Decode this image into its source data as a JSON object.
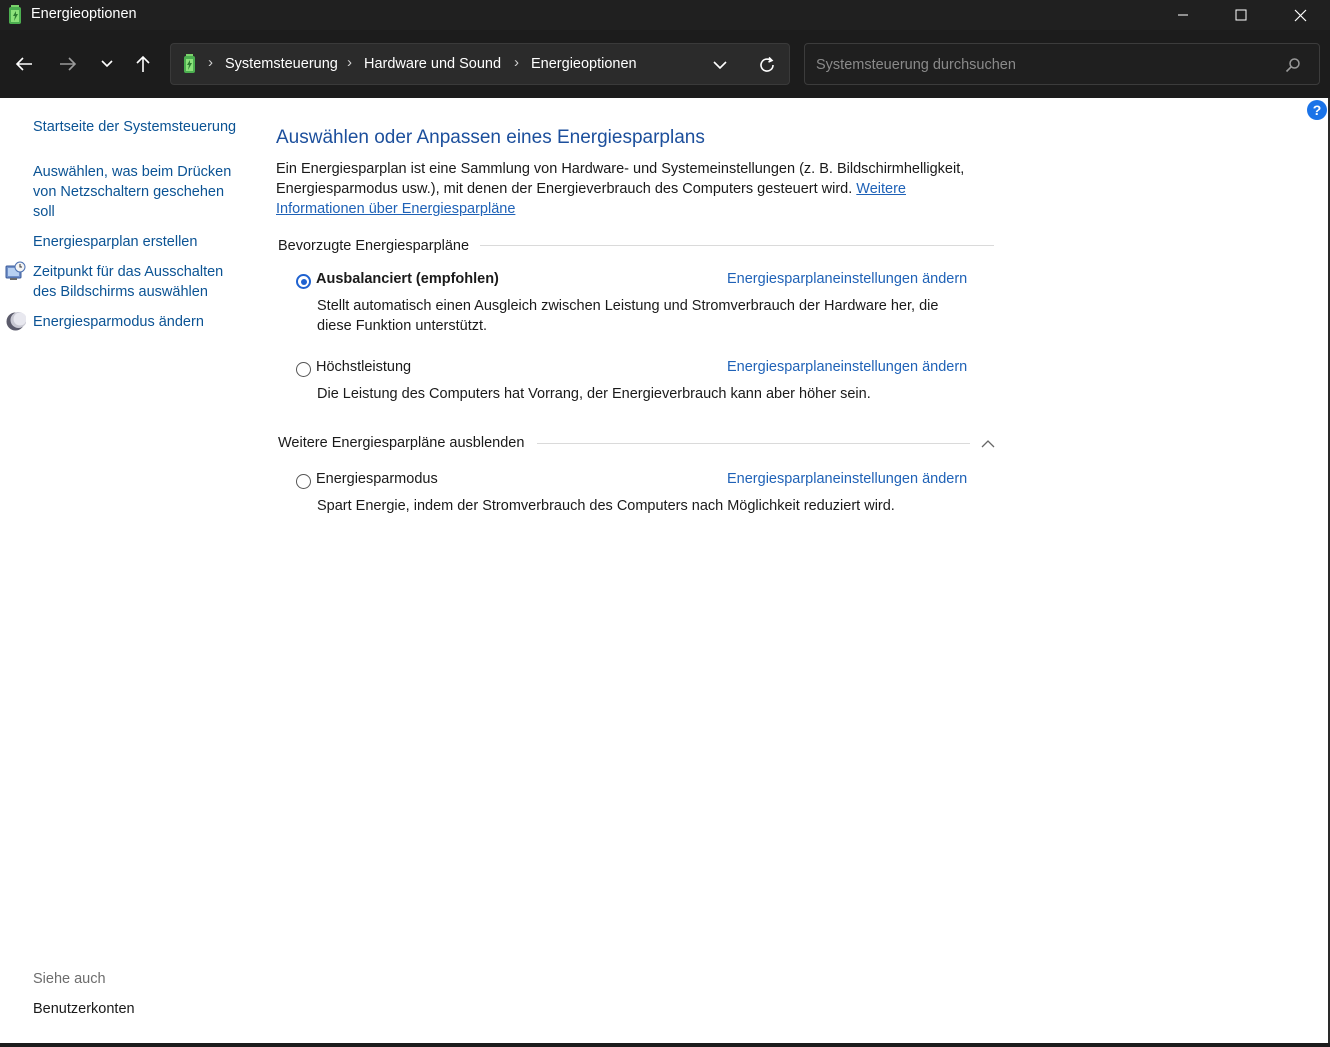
{
  "window": {
    "title": "Energieoptionen"
  },
  "address": {
    "crumbs": [
      "Systemsteuerung",
      "Hardware und Sound",
      "Energieoptionen"
    ],
    "separator": "›"
  },
  "search": {
    "placeholder": "Systemsteuerung durchsuchen"
  },
  "help": {
    "label": "?"
  },
  "sidebar": {
    "home": "Startseite der Systemsteuerung",
    "items": [
      {
        "label": "Auswählen, was beim Drücken von Netzschaltern geschehen soll",
        "icon": null
      },
      {
        "label": "Energiesparplan erstellen",
        "icon": null
      },
      {
        "label": "Zeitpunkt für das Ausschalten des Bildschirms auswählen",
        "icon": "display-clock-icon"
      },
      {
        "label": "Energiesparmodus ändern",
        "icon": "moon-icon"
      }
    ],
    "see_also": "Siehe auch",
    "see_also_items": [
      "Benutzerkonten"
    ]
  },
  "main": {
    "title": "Auswählen oder Anpassen eines Energiesparplans",
    "intro": "Ein Energiesparplan ist eine Sammlung von Hardware- und Systemeinstellungen (z. B. Bildschirmhelligkeit, Energiesparmodus usw.), mit denen der Energieverbrauch des Computers gesteuert wird.",
    "intro_link": "Weitere Informationen über Energiesparpläne",
    "preferred_header": "Bevorzugte Energiesparpläne",
    "more_header": "Weitere Energiesparpläne ausblenden",
    "plans": [
      {
        "name": "Ausbalanciert (empfohlen)",
        "selected": true,
        "description": "Stellt automatisch einen Ausgleich zwischen Leistung und Stromverbrauch der Hardware her, die diese Funktion unterstützt.",
        "link": "Energiesparplaneinstellungen ändern"
      },
      {
        "name": "Höchstleistung",
        "selected": false,
        "description": "Die Leistung des Computers hat Vorrang, der Energieverbrauch kann aber höher sein.",
        "link": "Energiesparplaneinstellungen ändern"
      },
      {
        "name": "Energiesparmodus",
        "selected": false,
        "description": "Spart Energie, indem der Stromverbrauch des Computers nach Möglichkeit reduziert wird.",
        "link": "Energiesparplaneinstellungen ändern"
      }
    ]
  },
  "colors": {
    "titlebar": "#202020",
    "navbar": "#1c1c1c",
    "link": "#1f62b7",
    "heading": "#1c4f9c",
    "radio_selected": "#1f62d0"
  }
}
